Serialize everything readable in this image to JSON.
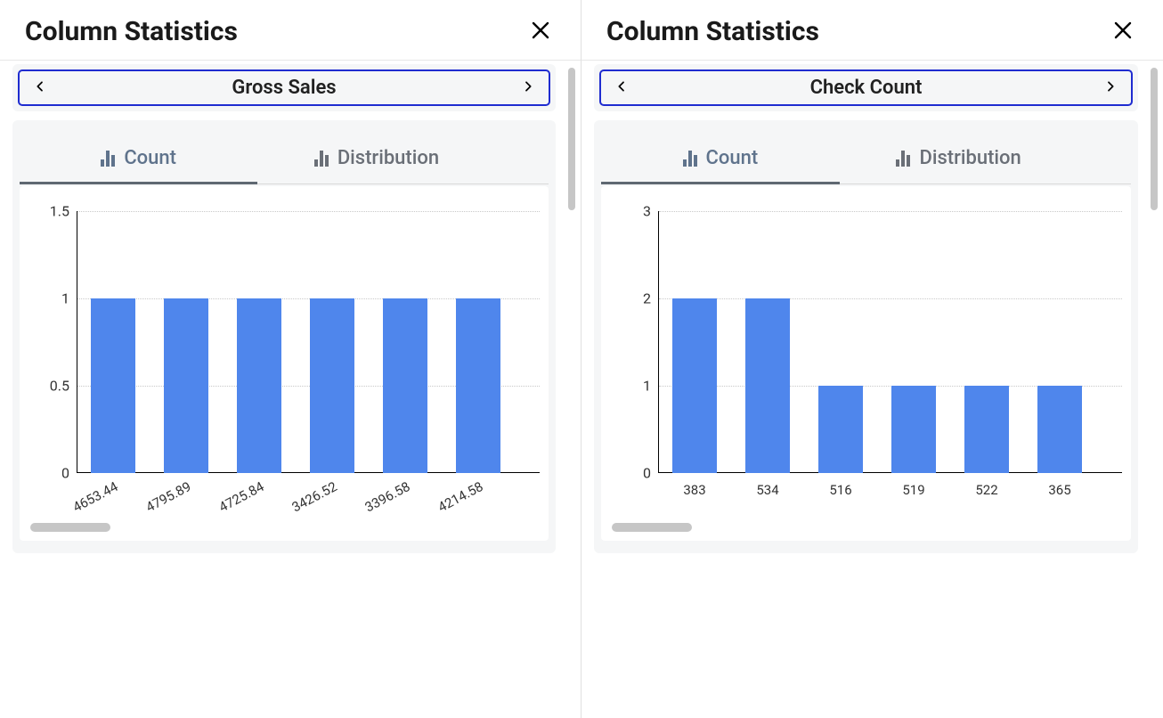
{
  "panels": [
    {
      "title": "Column Statistics",
      "column_name": "Gross Sales",
      "tabs": {
        "count": "Count",
        "distribution": "Distribution",
        "active": "count"
      }
    },
    {
      "title": "Column Statistics",
      "column_name": "Check Count",
      "tabs": {
        "count": "Count",
        "distribution": "Distribution",
        "active": "count"
      }
    }
  ],
  "colors": {
    "bar": "#4f86ec",
    "focus_outline": "#1f2cd0",
    "tab_active_text": "#5f738c",
    "tab_inactive_text": "#6a6f77",
    "card_bg": "#f5f6f7"
  },
  "chart_data": [
    {
      "type": "bar",
      "title": "",
      "xlabel": "",
      "ylabel": "",
      "categories": [
        "4653.44",
        "4795.89",
        "4725.84",
        "3426.52",
        "3396.58",
        "4214.58"
      ],
      "values": [
        1,
        1,
        1,
        1,
        1,
        1
      ],
      "ylim": [
        0,
        1.5
      ],
      "yticks": [
        0,
        0.5,
        1,
        1.5
      ],
      "xlabel_rotate": true
    },
    {
      "type": "bar",
      "title": "",
      "xlabel": "",
      "ylabel": "",
      "categories": [
        "383",
        "534",
        "516",
        "519",
        "522",
        "365"
      ],
      "values": [
        2,
        2,
        1,
        1,
        1,
        1
      ],
      "ylim": [
        0,
        3
      ],
      "yticks": [
        0,
        1,
        2,
        3
      ],
      "xlabel_rotate": false
    }
  ]
}
